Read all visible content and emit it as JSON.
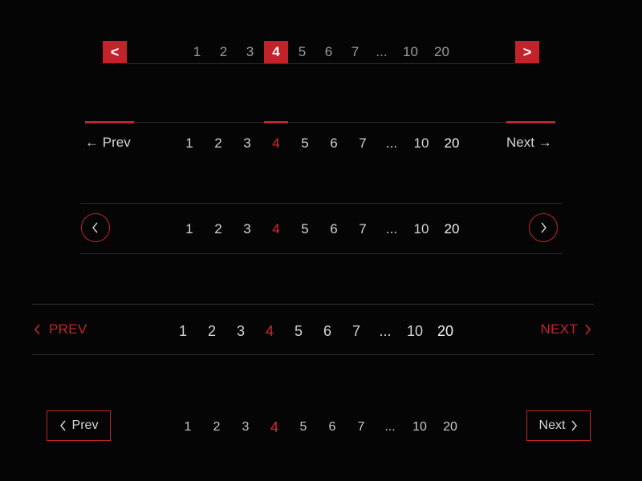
{
  "accent_color": "#c1232a",
  "pages": [
    "1",
    "2",
    "3",
    "4",
    "5",
    "6",
    "7",
    "...",
    "10",
    "20"
  ],
  "active_page": "4",
  "pagination_1": {
    "prev_label": "<",
    "next_label": ">"
  },
  "pagination_2": {
    "prev_label": "Prev",
    "next_label": "Next"
  },
  "pagination_3": {
    "prev_icon": "chevron-left-icon",
    "next_icon": "chevron-right-icon"
  },
  "pagination_4": {
    "prev_label": "PREV",
    "next_label": "NEXT"
  },
  "pagination_5": {
    "prev_label": "Prev",
    "next_label": "Next"
  }
}
